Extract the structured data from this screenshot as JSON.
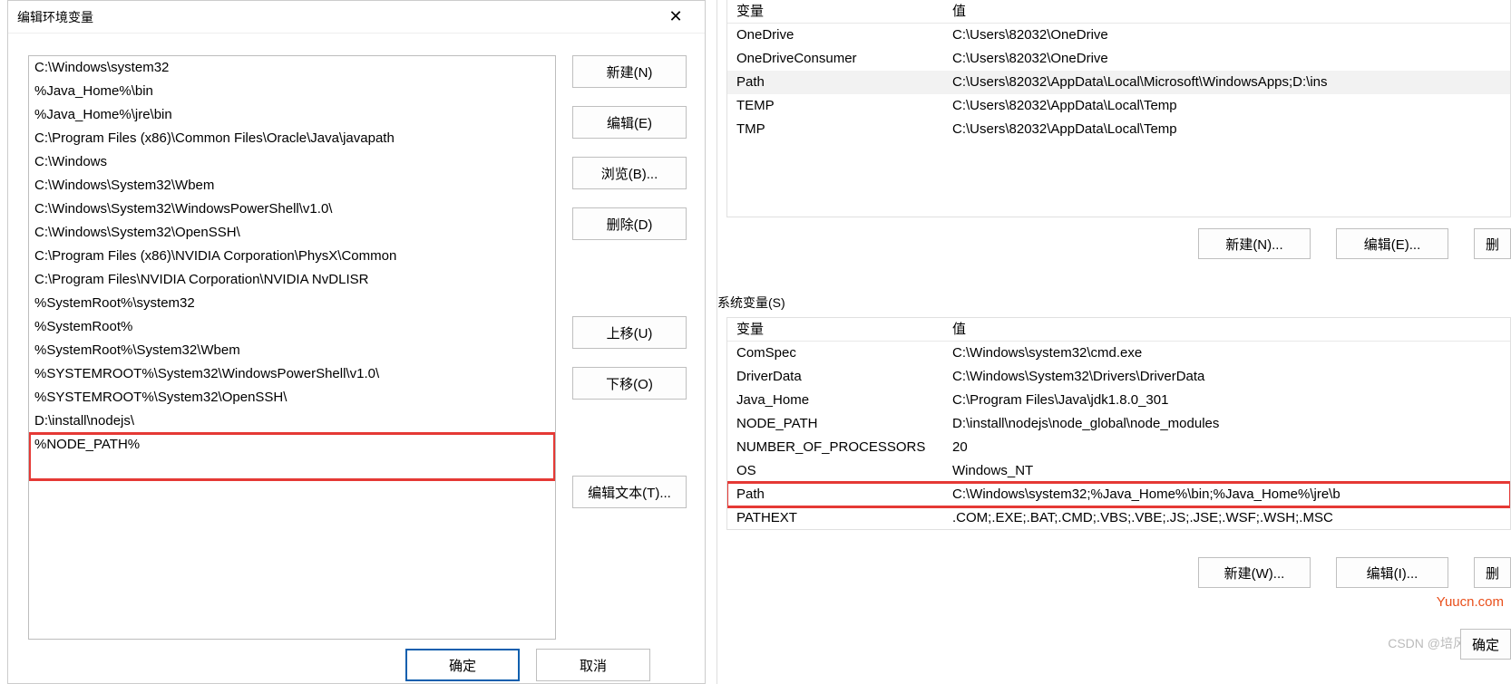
{
  "dialog": {
    "title": "编辑环境变量",
    "buttons": {
      "new": "新建(N)",
      "edit": "编辑(E)",
      "browse": "浏览(B)...",
      "delete": "删除(D)",
      "up": "上移(U)",
      "down": "下移(O)",
      "edit_text": "编辑文本(T)...",
      "ok": "确定",
      "cancel": "取消"
    },
    "paths": [
      "C:\\Windows\\system32",
      "%Java_Home%\\bin",
      "%Java_Home%\\jre\\bin",
      "C:\\Program Files (x86)\\Common Files\\Oracle\\Java\\javapath",
      "C:\\Windows",
      "C:\\Windows\\System32\\Wbem",
      "C:\\Windows\\System32\\WindowsPowerShell\\v1.0\\",
      "C:\\Windows\\System32\\OpenSSH\\",
      "C:\\Program Files (x86)\\NVIDIA Corporation\\PhysX\\Common",
      "C:\\Program Files\\NVIDIA Corporation\\NVIDIA NvDLISR",
      "%SystemRoot%\\system32",
      "%SystemRoot%",
      "%SystemRoot%\\System32\\Wbem",
      "%SYSTEMROOT%\\System32\\WindowsPowerShell\\v1.0\\",
      "%SYSTEMROOT%\\System32\\OpenSSH\\",
      "D:\\install\\nodejs\\",
      "%NODE_PATH%"
    ],
    "highlight_index": 16
  },
  "parent": {
    "headers": {
      "var": "变量",
      "val": "值"
    },
    "user_rows": [
      {
        "var": "OneDrive",
        "val": "C:\\Users\\82032\\OneDrive"
      },
      {
        "var": "OneDriveConsumer",
        "val": "C:\\Users\\82032\\OneDrive"
      },
      {
        "var": "Path",
        "val": "C:\\Users\\82032\\AppData\\Local\\Microsoft\\WindowsApps;D:\\ins"
      },
      {
        "var": "TEMP",
        "val": "C:\\Users\\82032\\AppData\\Local\\Temp"
      },
      {
        "var": "TMP",
        "val": "C:\\Users\\82032\\AppData\\Local\\Temp"
      }
    ],
    "user_selected_index": 2,
    "user_buttons": {
      "new": "新建(N)...",
      "edit": "编辑(E)...",
      "del": "删"
    },
    "system_label": "系统变量(S)",
    "system_rows": [
      {
        "var": "ComSpec",
        "val": "C:\\Windows\\system32\\cmd.exe"
      },
      {
        "var": "DriverData",
        "val": "C:\\Windows\\System32\\Drivers\\DriverData"
      },
      {
        "var": "Java_Home",
        "val": "C:\\Program Files\\Java\\jdk1.8.0_301"
      },
      {
        "var": "NODE_PATH",
        "val": "D:\\install\\nodejs\\node_global\\node_modules"
      },
      {
        "var": "NUMBER_OF_PROCESSORS",
        "val": "20"
      },
      {
        "var": "OS",
        "val": "Windows_NT"
      },
      {
        "var": "Path",
        "val": "C:\\Windows\\system32;%Java_Home%\\bin;%Java_Home%\\jre\\b"
      },
      {
        "var": "PATHEXT",
        "val": ".COM;.EXE;.BAT;.CMD;.VBS;.VBE;.JS;.JSE;.WSF;.WSH;.MSC"
      }
    ],
    "system_highlight_index": 6,
    "system_buttons": {
      "new": "新建(W)...",
      "edit": "编辑(I)...",
      "del": "删"
    },
    "footer_ok": "确定"
  },
  "watermarks": {
    "site": "Yuucn.com",
    "csdn": "CSDN @培风与图南"
  }
}
